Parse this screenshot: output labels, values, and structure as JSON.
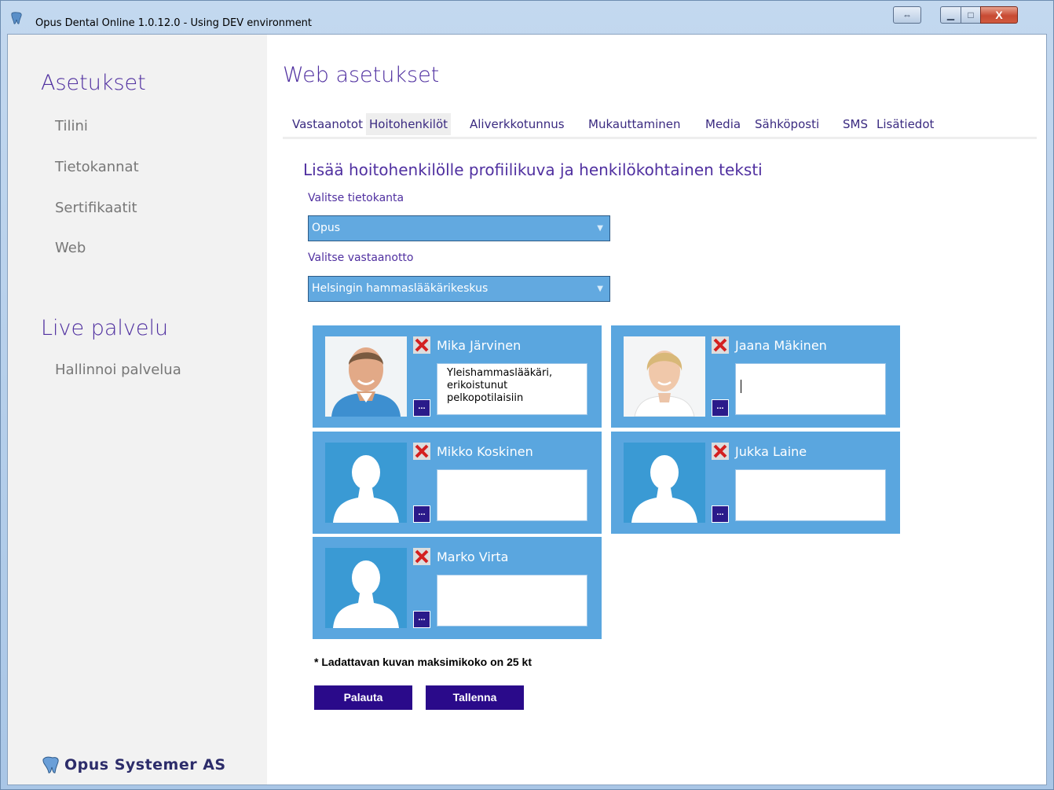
{
  "window": {
    "title": "Opus Dental Online 1.0.12.0 - Using DEV environment",
    "controls": {
      "resize": "⇔",
      "minimize": "▁",
      "maximize": "□",
      "close": "X"
    }
  },
  "sidebar": {
    "sections": [
      {
        "heading": "Asetukset",
        "items": [
          "Tilini",
          "Tietokannat",
          "Sertifikaatit",
          "Web"
        ]
      },
      {
        "heading": "Live palvelu",
        "items": [
          "Hallinnoi palvelua"
        ]
      }
    ],
    "logo_text": "Opus Systemer AS"
  },
  "main": {
    "title": "Web asetukset",
    "tabs": [
      {
        "label": "Vastaanotot",
        "active": false
      },
      {
        "label": "Hoitohenkilöt",
        "active": true
      },
      {
        "label": "Aliverkkotunnus",
        "active": false
      },
      {
        "label": "Mukauttaminen",
        "active": false
      },
      {
        "label": "Media",
        "active": false
      },
      {
        "label": "Sähköposti",
        "active": false
      },
      {
        "label": "SMS",
        "active": false
      },
      {
        "label": "Lisätiedot",
        "active": false
      }
    ],
    "section_title": "Lisää hoitohenkilölle profiilikuva ja henkilökohtainen teksti",
    "database": {
      "label": "Valitse tietokanta",
      "value": "Opus"
    },
    "clinic": {
      "label": "Valitse vastaanotto",
      "value": "Helsingin hammaslääkärikeskus"
    },
    "staff": [
      {
        "name": "Mika Järvinen",
        "bio": "Yleishammaslääkäri,\nerikoistunut\npelkopotilaisiin",
        "photo": "male-photo"
      },
      {
        "name": "Jaana Mäkinen",
        "bio": "",
        "photo": "female-photo"
      },
      {
        "name": "Mikko Koskinen",
        "bio": "",
        "photo": "placeholder"
      },
      {
        "name": "Jukka Laine",
        "bio": "",
        "photo": "placeholder"
      },
      {
        "name": "Marko Virta",
        "bio": "",
        "photo": "placeholder"
      }
    ],
    "browse_label": "...",
    "note": "* Ladattavan kuvan maksimikoko on 25 kt",
    "buttons": {
      "reset": "Palauta",
      "save": "Tallenna"
    }
  },
  "colors": {
    "accent_purple": "#5030a0",
    "card_blue": "#5aa6df",
    "button_dark": "#2a0a8a"
  }
}
